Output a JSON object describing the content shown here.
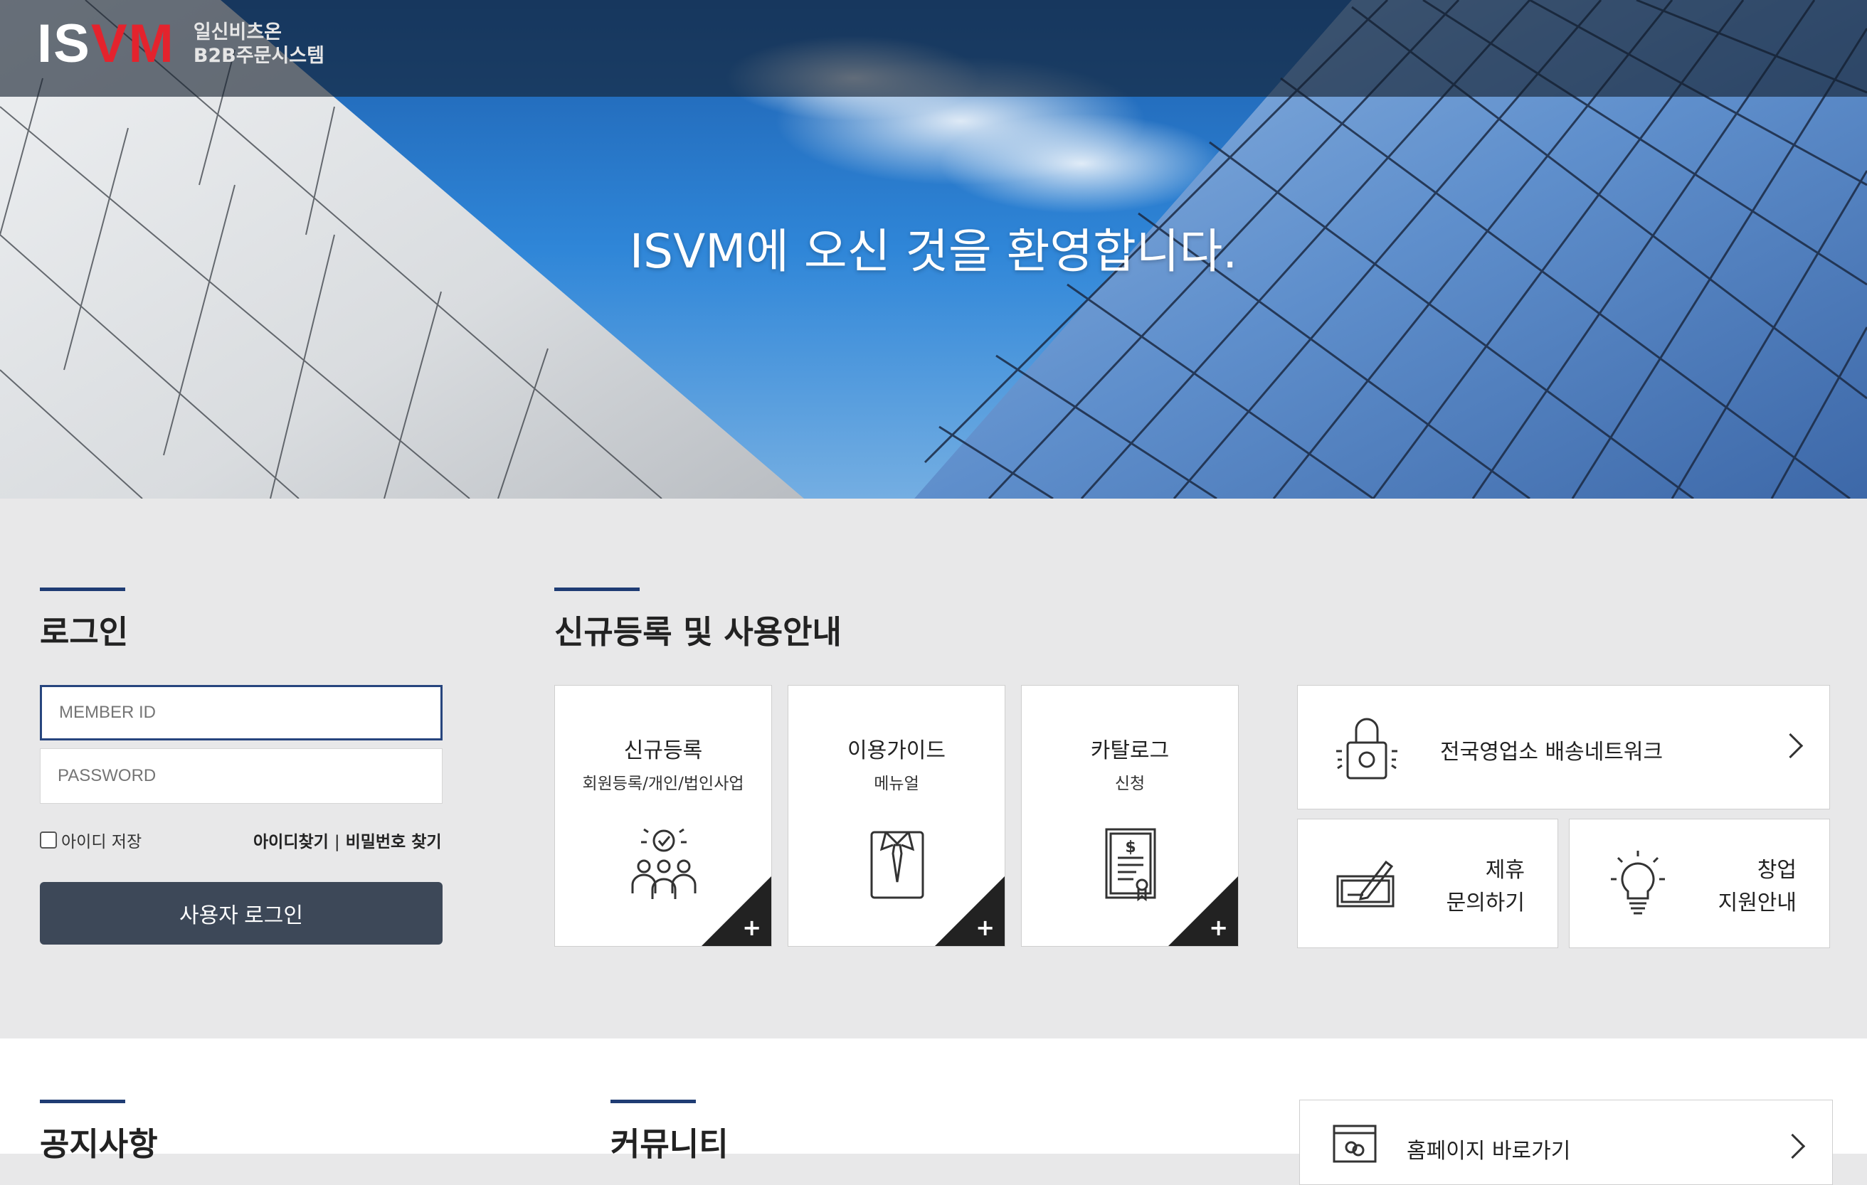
{
  "header": {
    "logo_text_white_1": "IS",
    "logo_text_red": "VM",
    "logo_sub_1": "일신비츠온",
    "logo_sub_2": "B2B주문시스템",
    "brand_red": "#e4232d"
  },
  "hero": {
    "title": "ISVM에 오신 것을 환영합니다."
  },
  "login": {
    "title": "로그인",
    "id_placeholder": "MEMBER ID",
    "pw_placeholder": "PASSWORD",
    "remember_label": "아이디 저장",
    "find_id": "아이디찾기",
    "separator": "|",
    "find_pw": "비밀번호 찾기",
    "submit": "사용자 로그인"
  },
  "guide": {
    "title": "신규등록 및 사용안내",
    "cards": [
      {
        "title": "신규등록",
        "subtitle": "회원등록/개인/법인사업",
        "icon": "people-check-icon",
        "plus": "+"
      },
      {
        "title": "이용가이드",
        "subtitle": "메뉴얼",
        "icon": "shirt-tie-icon",
        "plus": "+"
      },
      {
        "title": "카탈로그",
        "subtitle": "신청",
        "icon": "certificate-icon",
        "plus": "+"
      }
    ],
    "network_link": "전국영업소 배송네트워크",
    "partner_line1": "제휴",
    "partner_line2": "문의하기",
    "startup_line1": "창업",
    "startup_line2": "지원안내"
  },
  "bottom": {
    "notice_title": "공지사항",
    "community_title": "커뮤니티",
    "homepage_link": "홈페이지 바로가기"
  },
  "colors": {
    "accent": "#1f3c74",
    "button": "#3d4858",
    "background": "#e8e8e9"
  }
}
